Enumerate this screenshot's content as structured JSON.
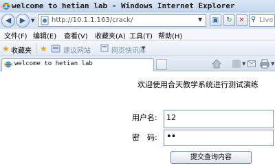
{
  "window": {
    "title": "welcome to hetian lab - Windows Internet Explorer"
  },
  "address_bar": {
    "url": "http://10.1.1.163/crack/",
    "search_placeholder": "Live",
    "nav_icons": [
      "back-icon",
      "forward-icon"
    ],
    "buttons": [
      "compatibility-view-icon",
      "refresh-icon",
      "stop-icon"
    ]
  },
  "menu": {
    "file": "文件(F)",
    "edit": "编辑(E)",
    "view": "查看(V)",
    "favorites": "收藏夹(A)",
    "tools": "工具(T)",
    "help": "帮助(H)"
  },
  "favorites_bar": {
    "favorites_label": "收藏夹",
    "suggested_sites": "建议网站",
    "web_slice_gallery": "网页快讯库"
  },
  "tab": {
    "label": "welcome to hetian lab"
  },
  "page": {
    "welcome": "欢迎使用合天教学系统进行测试演练",
    "username_label": "用户名:",
    "username_value": "12",
    "password_label": "密　码:",
    "password_value": "••",
    "submit_label": "提交查询内容"
  },
  "colors": {
    "accent": "#2e6db5",
    "chrome": "#d5e2f1"
  }
}
